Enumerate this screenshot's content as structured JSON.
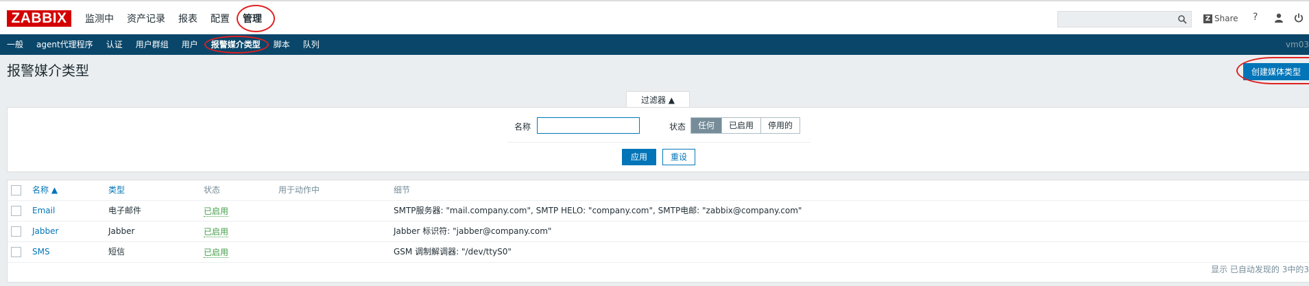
{
  "topbar": {
    "logo": "ZABBIX",
    "menu": [
      "监测中",
      "资产记录",
      "报表",
      "配置",
      "管理"
    ],
    "search_placeholder": "",
    "share_label": "Share",
    "help_label": "?"
  },
  "submenu": {
    "items": [
      "一般",
      "agent代理程序",
      "认证",
      "用户群组",
      "用户",
      "报警媒介类型",
      "脚本",
      "队列"
    ],
    "server": "vm03"
  },
  "page": {
    "title": "报警媒介类型",
    "create_button": "创建媒体类型"
  },
  "filter": {
    "tab_label": "过滤器 ▲",
    "name_label": "名称",
    "name_value": "",
    "status_label": "状态",
    "status_options": [
      "任何",
      "已启用",
      "停用的"
    ],
    "status_selected": "任何",
    "apply_label": "应用",
    "reset_label": "重设"
  },
  "table": {
    "headers": {
      "name": "名称 ▲",
      "type": "类型",
      "status": "状态",
      "used_in_actions": "用于动作中",
      "details": "细节"
    },
    "rows": [
      {
        "name": "Email",
        "type": "电子邮件",
        "status": "已启用",
        "used": "",
        "details": "SMTP服务器: \"mail.company.com\", SMTP HELO: \"company.com\", SMTP电邮: \"zabbix@company.com\""
      },
      {
        "name": "Jabber",
        "type": "Jabber",
        "status": "已启用",
        "used": "",
        "details": "Jabber 标识符: \"jabber@company.com\""
      },
      {
        "name": "SMS",
        "type": "短信",
        "status": "已启用",
        "used": "",
        "details": "GSM 调制解调器: \"/dev/ttyS0\""
      }
    ],
    "footer": "显示 已自动发现的 3中的3"
  },
  "colors": {
    "brand": "#d40000",
    "nav": "#0a466a",
    "primary": "#0275b8",
    "enabled": "#429e47",
    "highlight_circle": "#e02020"
  }
}
